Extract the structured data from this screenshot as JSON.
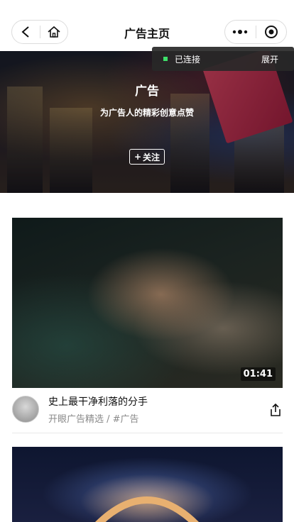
{
  "navbar": {
    "title": "广告主页",
    "back_icon": "back-arrow-icon",
    "home_icon": "home-icon",
    "more_icon": "more-dots-icon",
    "target_icon": "target-icon"
  },
  "connection": {
    "status": "已连接",
    "expand": "展开",
    "status_color": "#3ee06a"
  },
  "banner": {
    "title": "广告",
    "subtitle": "为广告人的精彩创意点赞",
    "follow_label": "关注",
    "follow_plus": "+"
  },
  "feed": [
    {
      "duration": "01:41",
      "title": "史上最干净利落的分手",
      "source": "开眼广告精选 / #广告",
      "share_icon": "share-icon"
    }
  ]
}
